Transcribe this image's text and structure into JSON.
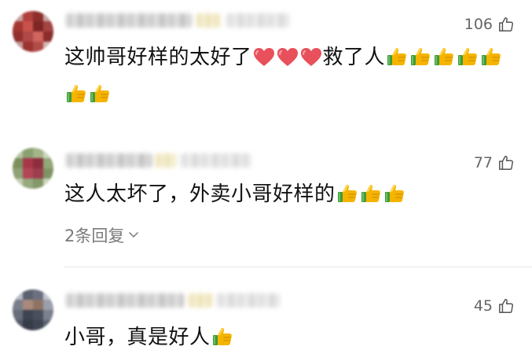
{
  "comments": [
    {
      "likes": "106",
      "segments": [
        {
          "t": "text",
          "v": "这帅哥好样的太好了"
        },
        {
          "t": "heart"
        },
        {
          "t": "heart"
        },
        {
          "t": "heart"
        },
        {
          "t": "text",
          "v": "救了人"
        },
        {
          "t": "thumb"
        },
        {
          "t": "thumb"
        },
        {
          "t": "thumb"
        },
        {
          "t": "thumb"
        },
        {
          "t": "thumb"
        },
        {
          "t": "thumb"
        },
        {
          "t": "thumb"
        }
      ]
    },
    {
      "likes": "77",
      "segments": [
        {
          "t": "text",
          "v": "这人太坏了，外卖小哥好样的"
        },
        {
          "t": "thumb"
        },
        {
          "t": "thumb"
        },
        {
          "t": "thumb"
        }
      ],
      "replies_label": "2条回复"
    },
    {
      "likes": "45",
      "segments": [
        {
          "t": "text",
          "v": "小哥，真是好人"
        },
        {
          "t": "thumb"
        }
      ]
    }
  ],
  "icons": {
    "like": "thumbs-up-outline-icon",
    "heart_emoji": "red-heart-emoji",
    "thumb_emoji": "thumbs-up-emoji",
    "expand": "chevron-down-icon"
  },
  "colors": {
    "text": "#111111",
    "meta": "#666666",
    "heart": "#e8505b",
    "thumb": "#f5b400",
    "divider": "#e6e6e6"
  }
}
